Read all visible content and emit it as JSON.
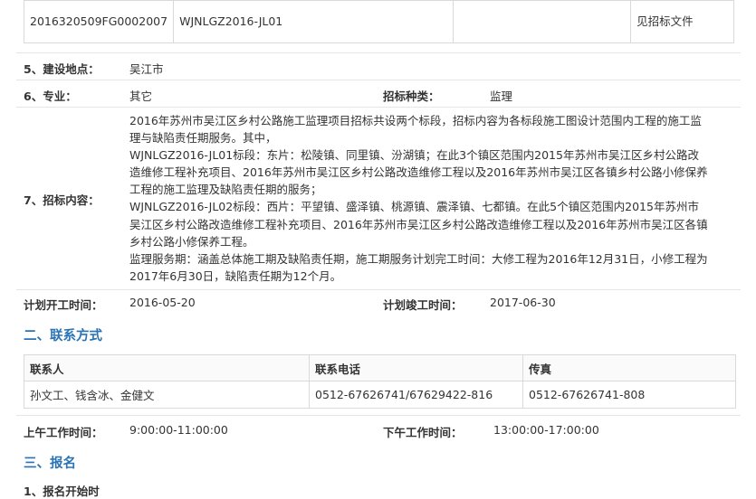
{
  "lot_table": {
    "lot_code": "2016320509FG0002007",
    "lot_name": "WJNLGZ2016-JL01",
    "note": "见招标文件"
  },
  "project": {
    "site_label": "5、建设地点：",
    "site_value": "吴江市",
    "major_label": "6、专业：",
    "major_value": "其它",
    "type_label": "招标种类：",
    "type_value": "监理",
    "content_label": "7、招标内容：",
    "content_lines": [
      "2016年苏州市吴江区乡村公路施工监理项目招标共设两个标段，招标内容为各标段施工图设计范围内工程的施工监",
      "理与缺陷责任期服务。其中，",
      "WJNLGZ2016-JL01标段：东片：松陵镇、同里镇、汾湖镇；在此3个镇区范围内2015年苏州市吴江区乡村公路改",
      "造维修工程补充项目、2016年苏州市吴江区乡村公路改造维修工程以及2016年苏州市吴江区各镇乡村公路小修保养",
      "工程的施工监理及缺陷责任期的服务；",
      "WJNLGZ2016-JL02标段：西片：平望镇、盛泽镇、桃源镇、震泽镇、七都镇。在此5个镇区范围内2015年苏州市",
      "吴江区乡村公路改造维修工程补充项目、2016年苏州市吴江区乡村公路改造维修工程以及2016年苏州市吴江区各镇",
      "乡村公路小修保养工程。",
      "监理服务期：涵盖总体施工期及缺陷责任期，施工期服务计划完工时间：大修工程为2016年12月31日，小修工程为",
      "2017年6月30日，缺陷责任期为12个月。"
    ],
    "start_label": "计划开工时间：",
    "start_value": "2016-05-20",
    "end_label": "计划竣工时间：",
    "end_value": "2017-06-30"
  },
  "contact": {
    "section_title": "二、联系方式",
    "headers": [
      "联系人",
      "联系电话",
      "传真"
    ],
    "row": [
      "孙文工、钱含冰、金健文",
      "0512-67626741/67629422-816",
      "0512-67626741-808"
    ],
    "am_label": "上午工作时间：",
    "am_value": "9:00:00-11:00:00",
    "pm_label": "下午工作时间：",
    "pm_value": "13:00:00-17:00:00"
  },
  "signup": {
    "section_title": "三、报名",
    "start_label": "1、报名开始时"
  }
}
